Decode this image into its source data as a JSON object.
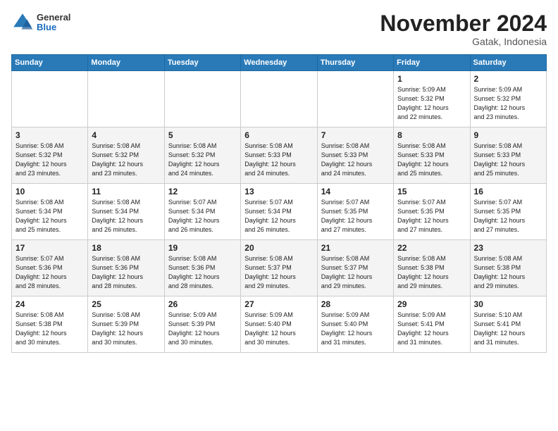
{
  "header": {
    "logo_general": "General",
    "logo_blue": "Blue",
    "month_title": "November 2024",
    "subtitle": "Gatak, Indonesia"
  },
  "columns": [
    "Sunday",
    "Monday",
    "Tuesday",
    "Wednesday",
    "Thursday",
    "Friday",
    "Saturday"
  ],
  "weeks": [
    [
      {
        "day": "",
        "info": ""
      },
      {
        "day": "",
        "info": ""
      },
      {
        "day": "",
        "info": ""
      },
      {
        "day": "",
        "info": ""
      },
      {
        "day": "",
        "info": ""
      },
      {
        "day": "1",
        "info": "Sunrise: 5:09 AM\nSunset: 5:32 PM\nDaylight: 12 hours\nand 22 minutes."
      },
      {
        "day": "2",
        "info": "Sunrise: 5:09 AM\nSunset: 5:32 PM\nDaylight: 12 hours\nand 23 minutes."
      }
    ],
    [
      {
        "day": "3",
        "info": "Sunrise: 5:08 AM\nSunset: 5:32 PM\nDaylight: 12 hours\nand 23 minutes."
      },
      {
        "day": "4",
        "info": "Sunrise: 5:08 AM\nSunset: 5:32 PM\nDaylight: 12 hours\nand 23 minutes."
      },
      {
        "day": "5",
        "info": "Sunrise: 5:08 AM\nSunset: 5:32 PM\nDaylight: 12 hours\nand 24 minutes."
      },
      {
        "day": "6",
        "info": "Sunrise: 5:08 AM\nSunset: 5:33 PM\nDaylight: 12 hours\nand 24 minutes."
      },
      {
        "day": "7",
        "info": "Sunrise: 5:08 AM\nSunset: 5:33 PM\nDaylight: 12 hours\nand 24 minutes."
      },
      {
        "day": "8",
        "info": "Sunrise: 5:08 AM\nSunset: 5:33 PM\nDaylight: 12 hours\nand 25 minutes."
      },
      {
        "day": "9",
        "info": "Sunrise: 5:08 AM\nSunset: 5:33 PM\nDaylight: 12 hours\nand 25 minutes."
      }
    ],
    [
      {
        "day": "10",
        "info": "Sunrise: 5:08 AM\nSunset: 5:34 PM\nDaylight: 12 hours\nand 25 minutes."
      },
      {
        "day": "11",
        "info": "Sunrise: 5:08 AM\nSunset: 5:34 PM\nDaylight: 12 hours\nand 26 minutes."
      },
      {
        "day": "12",
        "info": "Sunrise: 5:07 AM\nSunset: 5:34 PM\nDaylight: 12 hours\nand 26 minutes."
      },
      {
        "day": "13",
        "info": "Sunrise: 5:07 AM\nSunset: 5:34 PM\nDaylight: 12 hours\nand 26 minutes."
      },
      {
        "day": "14",
        "info": "Sunrise: 5:07 AM\nSunset: 5:35 PM\nDaylight: 12 hours\nand 27 minutes."
      },
      {
        "day": "15",
        "info": "Sunrise: 5:07 AM\nSunset: 5:35 PM\nDaylight: 12 hours\nand 27 minutes."
      },
      {
        "day": "16",
        "info": "Sunrise: 5:07 AM\nSunset: 5:35 PM\nDaylight: 12 hours\nand 27 minutes."
      }
    ],
    [
      {
        "day": "17",
        "info": "Sunrise: 5:07 AM\nSunset: 5:36 PM\nDaylight: 12 hours\nand 28 minutes."
      },
      {
        "day": "18",
        "info": "Sunrise: 5:08 AM\nSunset: 5:36 PM\nDaylight: 12 hours\nand 28 minutes."
      },
      {
        "day": "19",
        "info": "Sunrise: 5:08 AM\nSunset: 5:36 PM\nDaylight: 12 hours\nand 28 minutes."
      },
      {
        "day": "20",
        "info": "Sunrise: 5:08 AM\nSunset: 5:37 PM\nDaylight: 12 hours\nand 29 minutes."
      },
      {
        "day": "21",
        "info": "Sunrise: 5:08 AM\nSunset: 5:37 PM\nDaylight: 12 hours\nand 29 minutes."
      },
      {
        "day": "22",
        "info": "Sunrise: 5:08 AM\nSunset: 5:38 PM\nDaylight: 12 hours\nand 29 minutes."
      },
      {
        "day": "23",
        "info": "Sunrise: 5:08 AM\nSunset: 5:38 PM\nDaylight: 12 hours\nand 29 minutes."
      }
    ],
    [
      {
        "day": "24",
        "info": "Sunrise: 5:08 AM\nSunset: 5:38 PM\nDaylight: 12 hours\nand 30 minutes."
      },
      {
        "day": "25",
        "info": "Sunrise: 5:08 AM\nSunset: 5:39 PM\nDaylight: 12 hours\nand 30 minutes."
      },
      {
        "day": "26",
        "info": "Sunrise: 5:09 AM\nSunset: 5:39 PM\nDaylight: 12 hours\nand 30 minutes."
      },
      {
        "day": "27",
        "info": "Sunrise: 5:09 AM\nSunset: 5:40 PM\nDaylight: 12 hours\nand 30 minutes."
      },
      {
        "day": "28",
        "info": "Sunrise: 5:09 AM\nSunset: 5:40 PM\nDaylight: 12 hours\nand 31 minutes."
      },
      {
        "day": "29",
        "info": "Sunrise: 5:09 AM\nSunset: 5:41 PM\nDaylight: 12 hours\nand 31 minutes."
      },
      {
        "day": "30",
        "info": "Sunrise: 5:10 AM\nSunset: 5:41 PM\nDaylight: 12 hours\nand 31 minutes."
      }
    ]
  ]
}
